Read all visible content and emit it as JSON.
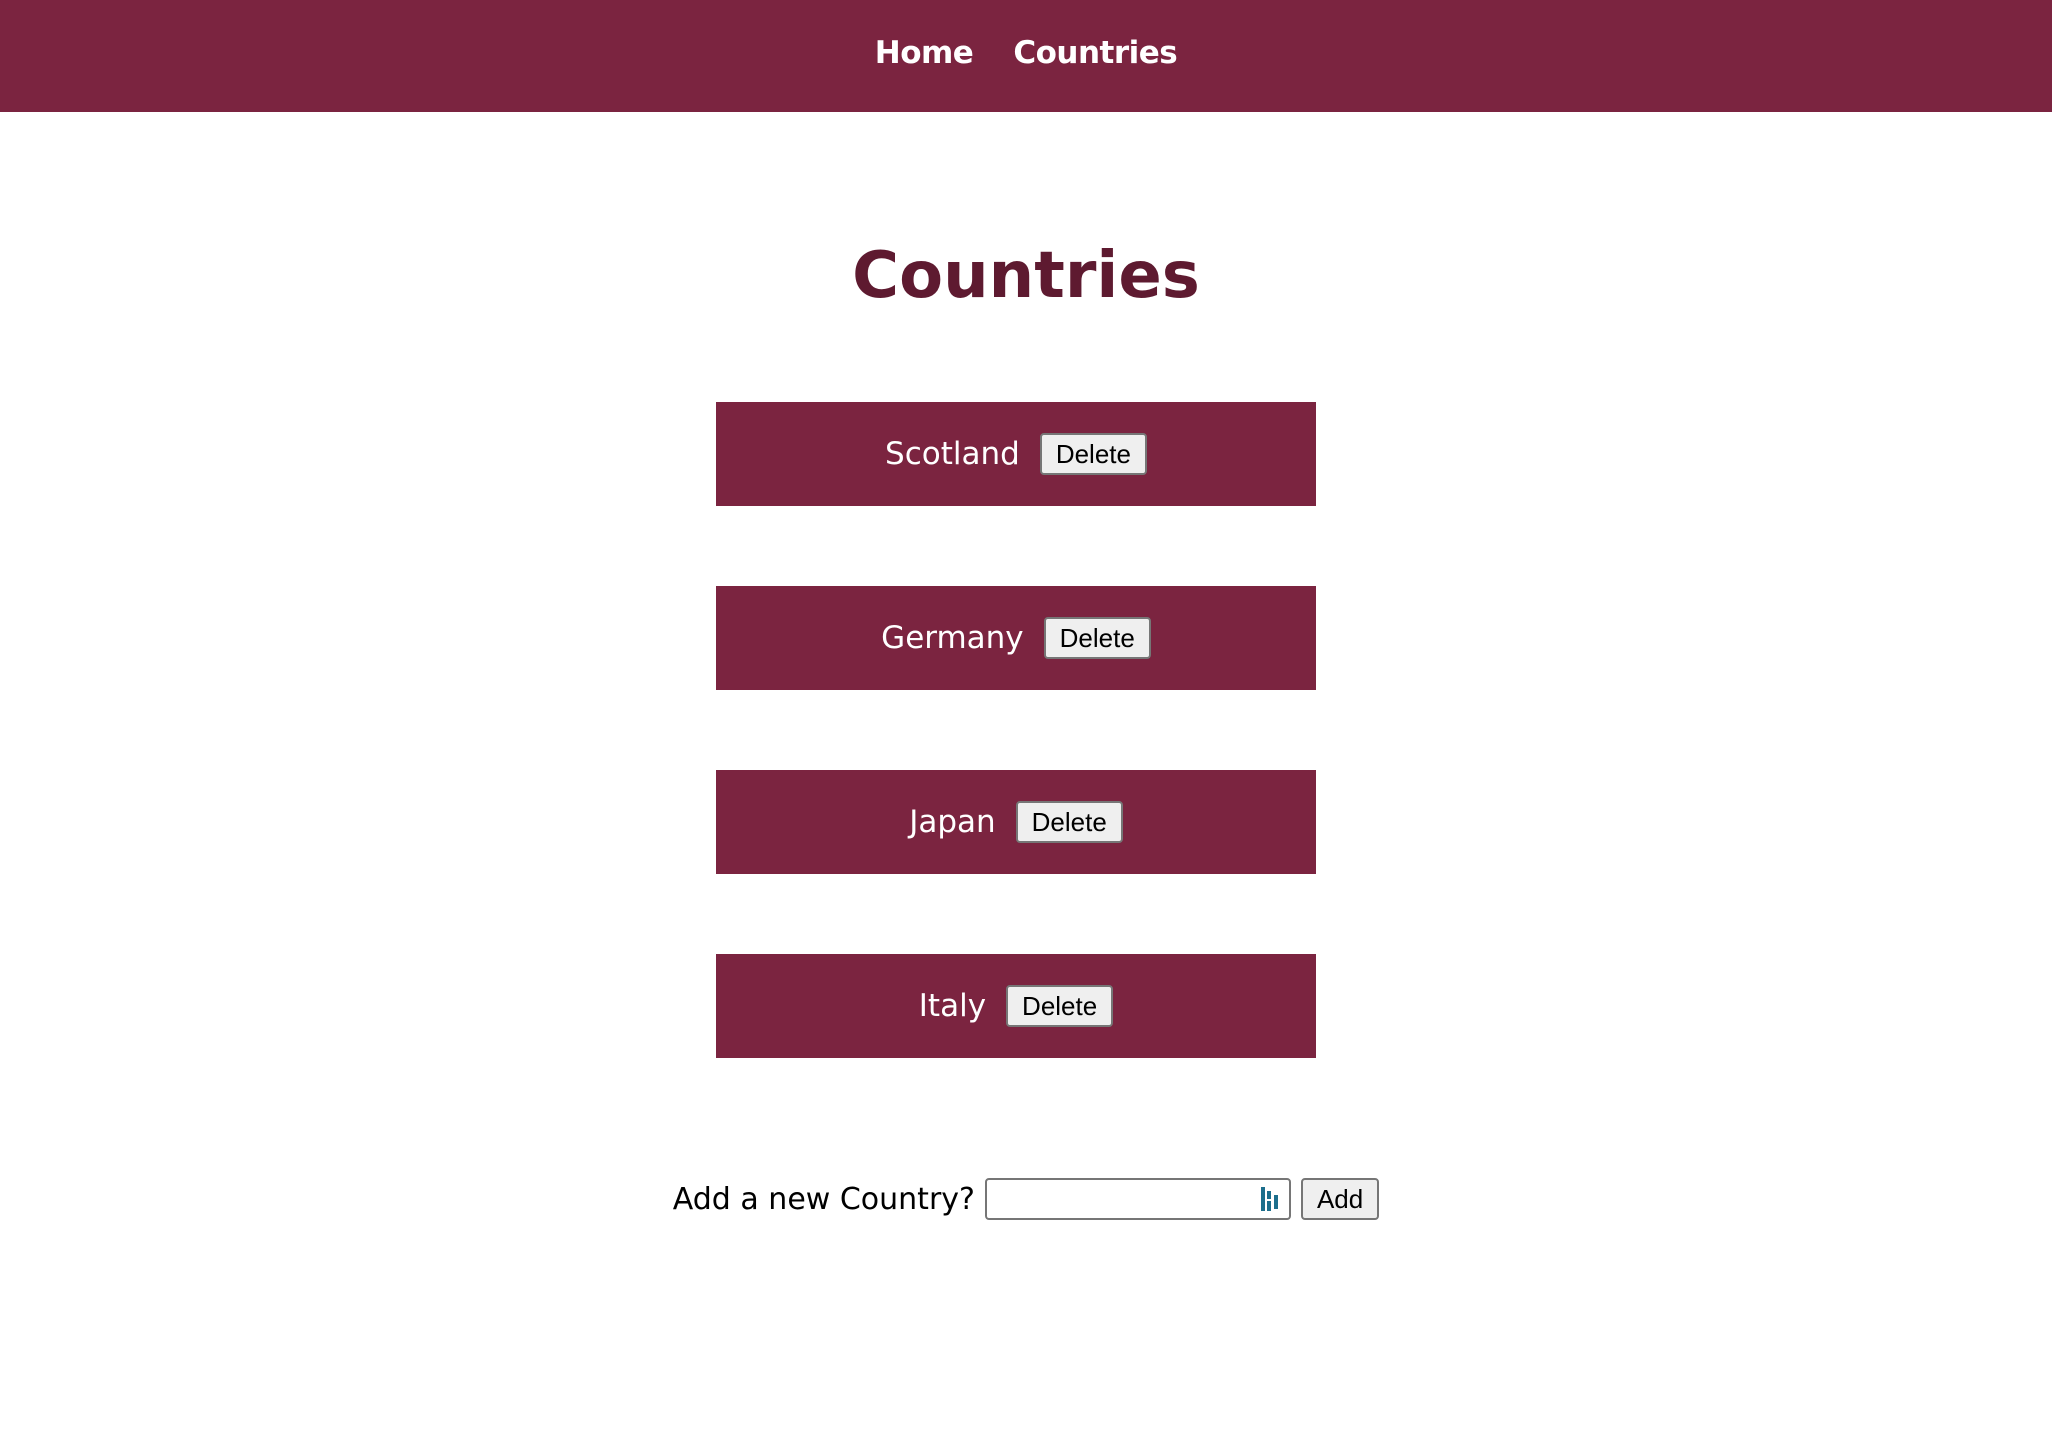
{
  "nav": {
    "links": [
      {
        "label": "Home"
      },
      {
        "label": "Countries"
      }
    ]
  },
  "page": {
    "title": "Countries"
  },
  "countries": [
    {
      "name": "Scotland",
      "delete_label": "Delete"
    },
    {
      "name": "Germany",
      "delete_label": "Delete"
    },
    {
      "name": "Japan",
      "delete_label": "Delete"
    },
    {
      "name": "Italy",
      "delete_label": "Delete"
    }
  ],
  "add_form": {
    "label": "Add a new Country?",
    "input_value": "",
    "button_label": "Add",
    "input_icon": "password-manager-icon"
  },
  "colors": {
    "brand": "#7b2440",
    "title": "#5e1a30",
    "icon": "#1c6e8c"
  }
}
